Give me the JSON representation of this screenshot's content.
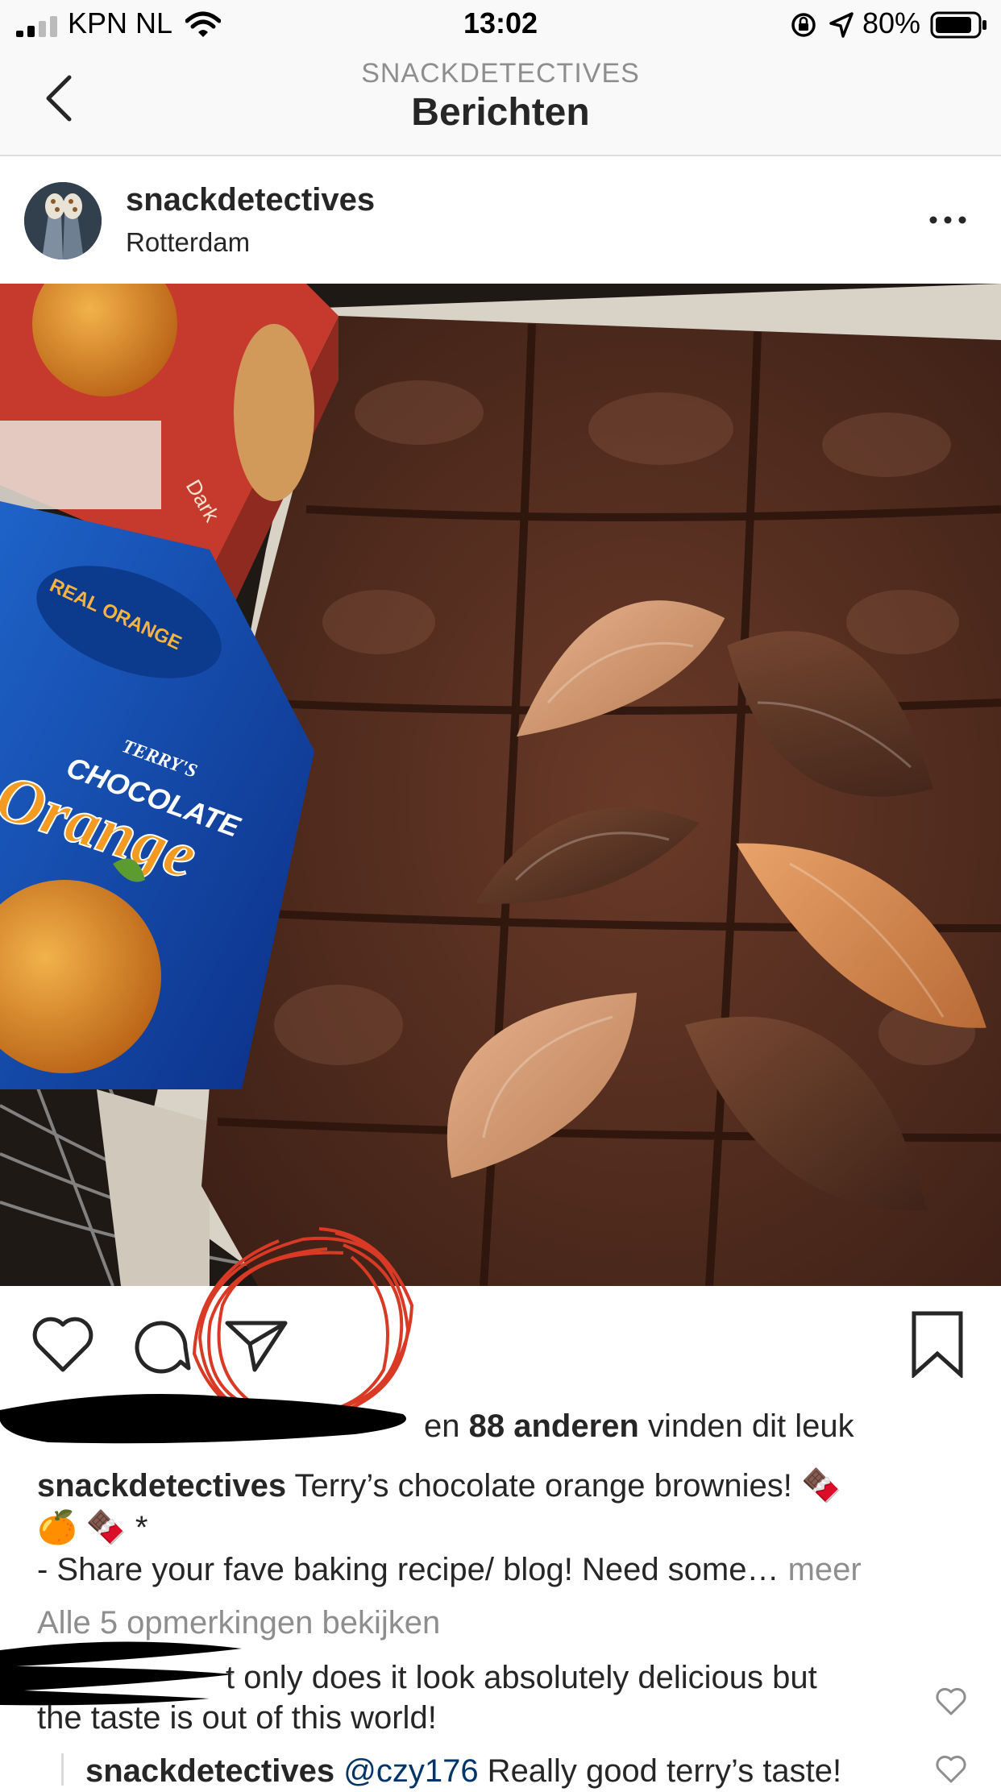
{
  "status_bar": {
    "carrier": "KPN NL",
    "time": "13:02",
    "battery": "80%",
    "icons": [
      "signal-icon",
      "wifi-icon",
      "rotation-lock-icon",
      "location-arrow-icon",
      "battery-icon"
    ]
  },
  "nav": {
    "subtitle": "SNACKDETECTIVES",
    "title": "Berichten",
    "back_icon": "chevron-left-icon"
  },
  "post": {
    "username": "snackdetectives",
    "location": "Rotterdam",
    "likes": {
      "prefix": "en ",
      "count": "88 anderen",
      "suffix": " vinden dit leuk"
    },
    "caption": {
      "username": "snackdetectives",
      "line1": " Terry’s chocolate orange brownies! 🍫",
      "line2": "🍊 🍫 *",
      "line3": "- Share your fave baking recipe/ blog! Need some… ",
      "more": "meer"
    },
    "view_all_comments": "Alle 5 opmerkingen bekijken",
    "comments": [
      {
        "line1": "t only does it look absolutely delicious but",
        "line2": "the taste is out of this world!"
      }
    ],
    "reply": {
      "username": "snackdetectives",
      "mention": "@czy176",
      "text": " Really good terry’s taste!"
    }
  },
  "photo": {
    "box_text_top": "Dark",
    "box_brand": "TERRY'S",
    "box_text1": "CHOCOLATE",
    "box_text2": "Orange",
    "box_badge": "REAL ORANGE"
  },
  "colors": {
    "accent_red": "#d93a25",
    "text": "#262626",
    "muted": "#8e8e8e",
    "mention": "#003569"
  }
}
